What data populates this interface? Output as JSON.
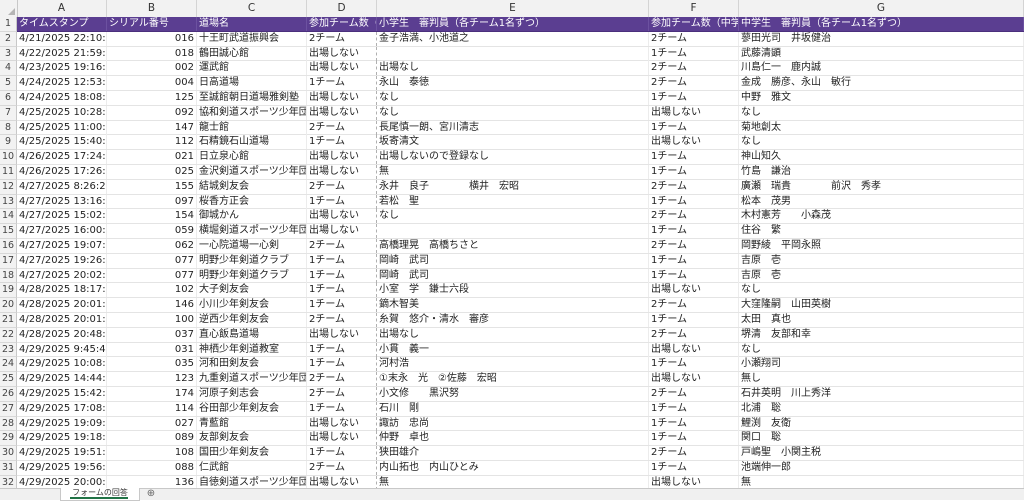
{
  "columns": [
    "A",
    "B",
    "C",
    "D",
    "E",
    "F",
    "G"
  ],
  "header": {
    "a": "タイムスタンプ",
    "b": "シリアル番号",
    "c": "道場名",
    "d": "参加チーム数（小学生）",
    "e": "小学生　審判員（各チーム1名ずつ）",
    "f": "参加チーム数（中学生）",
    "g": "中学生　審判員（各チーム1名ずつ）"
  },
  "rows": [
    [
      "4/21/2025 22:10:50",
      "016",
      "十王町武道振興会",
      "2チーム",
      "金子浩満、小池道之",
      "2チーム",
      "蓼田光司　井坂健治"
    ],
    [
      "4/22/2025 21:59:55",
      "018",
      "鶴田誠心館",
      "出場しない",
      "",
      "1チーム",
      "武藤清顕"
    ],
    [
      "4/23/2025 19:16:09",
      "002",
      "運武館",
      "出場しない",
      "出場なし",
      "2チーム",
      "川島仁一　鹿内誠"
    ],
    [
      "4/24/2025 12:53:19",
      "004",
      "日高道場",
      "1チーム",
      "永山　泰徳",
      "2チーム",
      "金成　勝彦、永山　敏行"
    ],
    [
      "4/24/2025 18:08:50",
      "125",
      "至誠館朝日道場雅剣塾",
      "出場しない",
      "なし",
      "1チーム",
      "中野　雅文"
    ],
    [
      "4/25/2025 10:28:56",
      "092",
      "協和剣道スポーツ少年団",
      "出場しない",
      "なし",
      "出場しない",
      "なし"
    ],
    [
      "4/25/2025 11:00:36",
      "147",
      "龍士館",
      "2チーム",
      "長尾慎一朗、宮川清志",
      "1チーム",
      "菊地創太"
    ],
    [
      "4/25/2025 15:40:37",
      "112",
      "石精鏡石山道場",
      "1チーム",
      "坂寄清文",
      "出場しない",
      "なし"
    ],
    [
      "4/26/2025 17:24:19",
      "021",
      "日立泉心館",
      "出場しない",
      "出場しないので登録なし",
      "1チーム",
      "神山知久"
    ],
    [
      "4/26/2025 17:26:26",
      "025",
      "金沢剣道スポーツ少年団",
      "出場しない",
      "無",
      "1チーム",
      "竹島　謙治"
    ],
    [
      "4/27/2025 8:26:28",
      "155",
      "結城剣友会",
      "2チーム",
      "永井　良子　　　　横井　宏昭",
      "2チーム",
      "廣瀬　瑞貴　　　　前沢　秀孝"
    ],
    [
      "4/27/2025 13:16:53",
      "097",
      "桜香方正会",
      "1チーム",
      "若松　聖",
      "1チーム",
      "松本　茂男"
    ],
    [
      "4/27/2025 15:02:14",
      "154",
      "御城かん",
      "出場しない",
      "なし",
      "2チーム",
      "木村憲芳　　小森茂"
    ],
    [
      "4/27/2025 16:00:08",
      "059",
      "横堀剣道スポーツ少年団",
      "出場しない",
      "",
      "1チーム",
      "住谷　繁"
    ],
    [
      "4/27/2025 19:07:32",
      "062",
      "一心院道場一心剣",
      "2チーム",
      "高橋理晃　高橋ちさと",
      "2チーム",
      "岡野綾　平岡永照"
    ],
    [
      "4/27/2025 19:26:37",
      "077",
      "明野少年剣道クラブ",
      "1チーム",
      "岡崎　武司",
      "1チーム",
      "吉原　壱"
    ],
    [
      "4/27/2025 20:02:07",
      "077",
      "明野少年剣道クラブ",
      "1チーム",
      "岡崎　武司",
      "1チーム",
      "吉原　壱"
    ],
    [
      "4/28/2025 18:17:52",
      "102",
      "大子剣友会",
      "1チーム",
      "小室　学　鎌士六段",
      "出場しない",
      "なし"
    ],
    [
      "4/28/2025 20:01:27",
      "146",
      "小川少年剣友会",
      "1チーム",
      "鏑木智美",
      "2チーム",
      "大窪隆嗣　山田英樹"
    ],
    [
      "4/28/2025 20:01:58",
      "100",
      "逆西少年剣友会",
      "2チーム",
      "糸賀　悠介・清水　審彦",
      "1チーム",
      "太田　真也"
    ],
    [
      "4/28/2025 20:48:56",
      "037",
      "直心飯島道場",
      "出場しない",
      "出場なし",
      "2チーム",
      "堺清　友部和幸"
    ],
    [
      "4/29/2025 9:45:48",
      "031",
      "神栖少年剣道教室",
      "1チーム",
      "小貫　義一",
      "出場しない",
      "なし"
    ],
    [
      "4/29/2025 10:08:29",
      "035",
      "河和田剣友会",
      "1チーム",
      "河村浩",
      "1チーム",
      "小瀬翔司"
    ],
    [
      "4/29/2025 14:44:21",
      "123",
      "九重剣道スポーツ少年団",
      "2チーム",
      "①末永　光　②佐藤　宏昭",
      "出場しない",
      "無し"
    ],
    [
      "4/29/2025 15:42:29",
      "174",
      "河原子剣志会",
      "2チーム",
      "小文修　　黒沢努",
      "2チーム",
      "石井英明　川上秀洋"
    ],
    [
      "4/29/2025 17:08:02",
      "114",
      "谷田部少年剣友会",
      "1チーム",
      "石川　剛",
      "1チーム",
      "北浦　聡"
    ],
    [
      "4/29/2025 19:09:09",
      "027",
      "青藍館",
      "出場しない",
      "諏訪　忠尚",
      "1チーム",
      "鯉渕　友衛"
    ],
    [
      "4/29/2025 19:18:37",
      "089",
      "友部剣友会",
      "出場しない",
      "仲野　卓也",
      "1チーム",
      "関口　聡"
    ],
    [
      "4/29/2025 19:51:36",
      "108",
      "国田少年剣友会",
      "1チーム",
      "狭田雄介",
      "2チーム",
      "戸嶋聖　小関主税"
    ],
    [
      "4/29/2025 19:56:18",
      "088",
      "仁武館",
      "2チーム",
      "内山拓也　内山ひとみ",
      "1チーム",
      "池端伸一郎"
    ],
    [
      "4/29/2025 20:00:12",
      "136",
      "自徳剣道スポーツ少年団",
      "出場しない",
      "無",
      "出場しない",
      "無"
    ],
    [
      "4/29/2025 20:04:24",
      "048",
      "つくば少年剣友会",
      "出場しない",
      "出場しない",
      "出場しない",
      "出場しない"
    ]
  ],
  "row_numbers": [
    "1",
    "2",
    "3",
    "4",
    "5",
    "6",
    "7",
    "8",
    "9",
    "10",
    "11",
    "12",
    "13",
    "14",
    "15",
    "16",
    "17",
    "18",
    "19",
    "20",
    "21",
    "22",
    "23",
    "24",
    "25",
    "26",
    "27",
    "28",
    "29",
    "30",
    "31",
    "32",
    "33"
  ],
  "sheet_tab": "フォームの回答",
  "colors": {
    "header_bg": "#5b3e91",
    "header_text": "#ffffff"
  }
}
